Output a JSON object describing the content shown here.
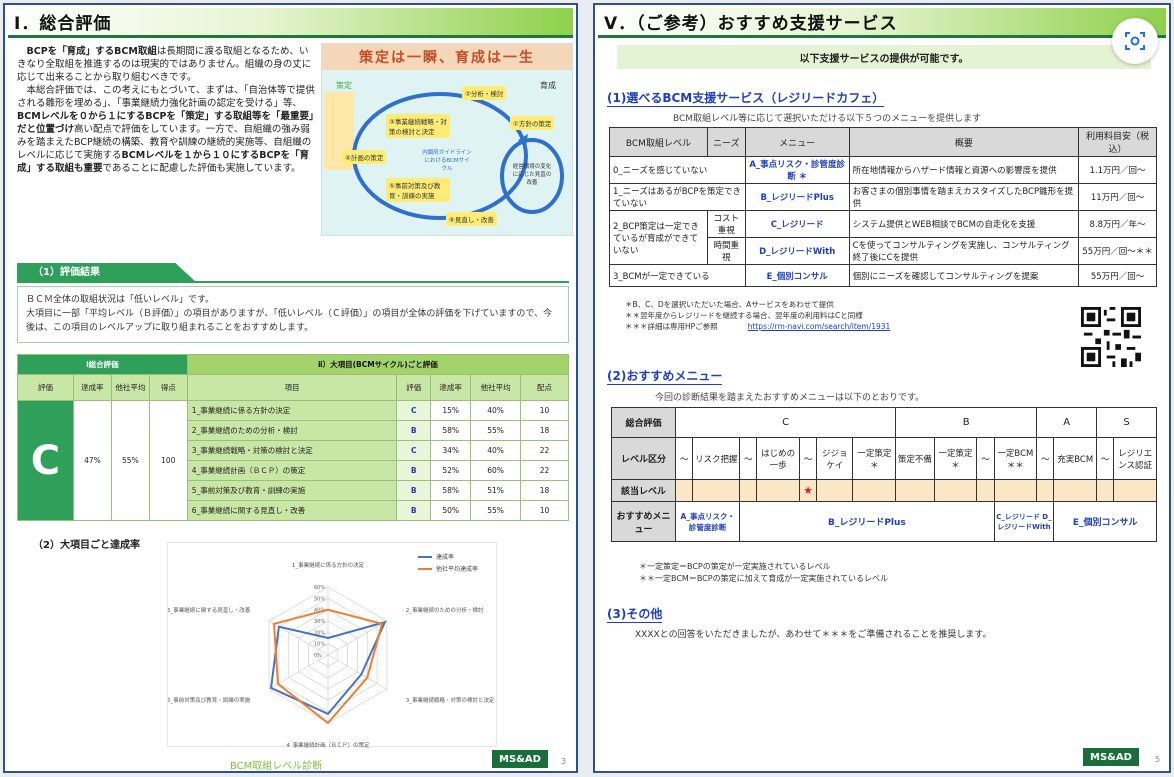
{
  "left": {
    "title": "Ⅰ．総合評価",
    "intro_p1_a": "BCPを「育成」するBCM取組",
    "intro_p1_b": "は長期間に渡る取組となるため、いきなり全取組を推進するのは現実的ではありません。組織の身の丈に応じて出来ることから取り組むべきです。",
    "intro_p2_a": "本総合評価では、この考えにもとづいて、まずは、「自治体等で提供される雛形を埋める」、「事業継続力強化計画の認定を受ける」等、",
    "intro_p2_b": "BCMレベルを０から１にするBCPを「策定」する取組等を「最重要」だと位置づけ",
    "intro_p2_c": "高い配点で評価をしています。一方で、自組織の強み弱みを踏まえたBCP継続の構築、教育や訓練の継続的実施等、自組織のレベルに応じて実施する",
    "intro_p2_d": "BCMレベルを１から１０にするBCPを「育成」する取組も重要",
    "intro_p2_e": "であることに配慮した評価も実施しています。",
    "image": {
      "banner": "策定は一瞬、育成は一生",
      "label_left": "策定",
      "label_right": "育成",
      "steps": [
        "②分析・検討",
        "③事業継続戦略・対策の検討と決定",
        "④計画の策定",
        "⑤事前対策及び教育・訓練の実施",
        "⑥見直し・改善",
        "①方針の策定"
      ],
      "center": "内閣府ガイドラインにおけるBCMサイクル",
      "right_box": "経営環境の変化に応じた見直の改善"
    },
    "eval_tab": "（1）評価結果",
    "eval_text_1": "ＢＣＭ全体の取組状況は「低いレベル」です。",
    "eval_text_2": "大項目に一部「平均レベル（Ｂ評価）」の項目がありますが、「低いレベル（Ｃ評価）」の項目が全体の評価を下げていますので、今後は、この項目のレベルアップに取り組まれることをおすすめします。",
    "table": {
      "header_left": "ⅰ総合評価",
      "header_right": "ⅱ）大項目(BCMサイクル)ごと評価",
      "col_left": [
        "評価",
        "達成率",
        "他社平均",
        "得点"
      ],
      "col_right": [
        "項目",
        "評価",
        "達成率",
        "他社平均",
        "配点"
      ],
      "overall": {
        "grade": "C",
        "rate": "47%",
        "avg": "55%",
        "score": "100"
      },
      "rows": [
        {
          "item": "1_事業継続に係る方針の決定",
          "grade": "C",
          "rate": "15%",
          "avg": "40%",
          "points": "10"
        },
        {
          "item": "2_事業継続のための分析・検討",
          "grade": "B",
          "rate": "58%",
          "avg": "55%",
          "points": "18"
        },
        {
          "item": "3_事業継続戦略・対策の検討と決定",
          "grade": "C",
          "rate": "34%",
          "avg": "40%",
          "points": "22"
        },
        {
          "item": "4_事業継続計画（ＢＣＰ）の策定",
          "grade": "B",
          "rate": "52%",
          "avg": "60%",
          "points": "22"
        },
        {
          "item": "5_事前対策及び教育・訓練の実施",
          "grade": "B",
          "rate": "58%",
          "avg": "51%",
          "points": "18"
        },
        {
          "item": "6_事業継続に関する見直し・改善",
          "grade": "B",
          "rate": "50%",
          "avg": "55%",
          "points": "10"
        }
      ]
    },
    "sub2": "（2）大項目ごと達成率",
    "footer": "BCM取組レベル診断",
    "logo": "MS&AD",
    "page": "3"
  },
  "chart_data": {
    "type": "radar",
    "categories": [
      "1_事業継続に係る方針の決定",
      "2_事業継続のための分析・検討",
      "3_事業継続戦略・対策の検討と決定",
      "4_事業継続計画（ＢＣＰ）の策定",
      "5_事前対策及び教育・訓練の実施",
      "6_事業継続に関する見直し・改善"
    ],
    "series": [
      {
        "name": "達成率",
        "values": [
          15,
          58,
          34,
          52,
          58,
          50
        ],
        "color": "#4472c4"
      },
      {
        "name": "他社平均達成率",
        "values": [
          40,
          55,
          40,
          60,
          51,
          55
        ],
        "color": "#ed7d31"
      }
    ],
    "ticks": [
      "0%",
      "10%",
      "20%",
      "30%",
      "40%",
      "50%",
      "60%"
    ],
    "rmax": 60,
    "legend": "top-right"
  },
  "right": {
    "title": "Ⅴ．（ご参考）おすすめ支援サービス",
    "avail": "以下支援サービスの提供が可能です。",
    "sec1": "(1)選べるBCM支援サービス（レジリードカフェ）",
    "sec1_desc": "BCM取組レベル等に応じて選択いただける以下５つのメニューを提供します",
    "svc_headers": [
      "BCM取組レベル",
      "ニーズ",
      "メニュー",
      "概要",
      "利用料目安（税込）"
    ],
    "svc_rows": [
      {
        "level": "0_ニーズを感じていない",
        "needs": "",
        "menu": "A_事点リスク・診管度診断 ＊",
        "desc": "所在地情報からハザード情報と資源への影響度を提供",
        "price": "1.1万円／回〜"
      },
      {
        "level": "1_ニーズはあるがBCPを策定できていない",
        "needs": "",
        "menu": "B_レジリードPlus",
        "desc": "お客さまの個別事情を踏まえカスタイズしたBCP雛形を提供",
        "price": "11万円／回〜"
      },
      {
        "level": "2_BCP策定は一定できているが育成ができていない",
        "needs": "コスト重視",
        "menu": "C_レジリード",
        "desc": "システム提供とWEB相談でBCMの自走化を支援",
        "price": "8.8万円／年〜"
      },
      {
        "level": "",
        "needs": "時間重視",
        "menu": "D_レジリードWith",
        "desc": "Cを使ってコンサルティングを実施し、コンサルティング終了後にCを提供",
        "price": "55万円／回〜＊＊"
      },
      {
        "level": "3_BCMが一定できている",
        "needs": "",
        "menu": "E_個別コンサル",
        "desc": "個別にニーズを確認してコンサルティングを提案",
        "price": "55万円／回〜"
      }
    ],
    "notes1": [
      "＊B、C、Dを選択いただいた場合、Aサービスをあわせて提供",
      "＊＊翌年度からレジリードを継続する場合、翌年度の利用料はCと同様",
      "＊＊＊詳細は専用HPご参照"
    ],
    "url": "https://rm-navi.com/search/item/1931",
    "sec2": "(2)おすすめメニュー",
    "sec2_desc": "今回の診断結果を踏まえたおすすめメニューは以下のとおりです。",
    "menu_tbl": {
      "r1_label": "総合評価",
      "grades": [
        "C",
        "B",
        "A",
        "S"
      ],
      "r2_label": "レベル区分",
      "levels": [
        "〜",
        "リスク把握",
        "〜",
        "はじめの一歩",
        "〜",
        "ジジョケイ",
        "一定策定＊",
        "策定不備",
        "一定策定＊",
        "〜",
        "一定BCM＊＊",
        "〜",
        "充実BCM",
        "〜",
        "レジリエンス認証"
      ],
      "r3_label": "該当レベル",
      "star": "★",
      "r4_label": "おすすめメニュー",
      "menu_a": "A_事点リスク・診管度診断",
      "menu_b": "B_レジリードPlus",
      "menu_cd": "C_レジリード D_レジリードWith",
      "menu_e": "E_個別コンサル"
    },
    "notes2": [
      "＊一定策定＝BCPの策定が一定実施されているレベル",
      "＊＊一定BCM＝BCPの策定に加えて育成が一定実施されているレベル"
    ],
    "sec3": "(3)その他",
    "sec3_text": "XXXXとの回答をいただきましたが、あわせて＊＊＊をご準備されることを推奨します。",
    "logo": "MS&AD",
    "page": "5"
  }
}
